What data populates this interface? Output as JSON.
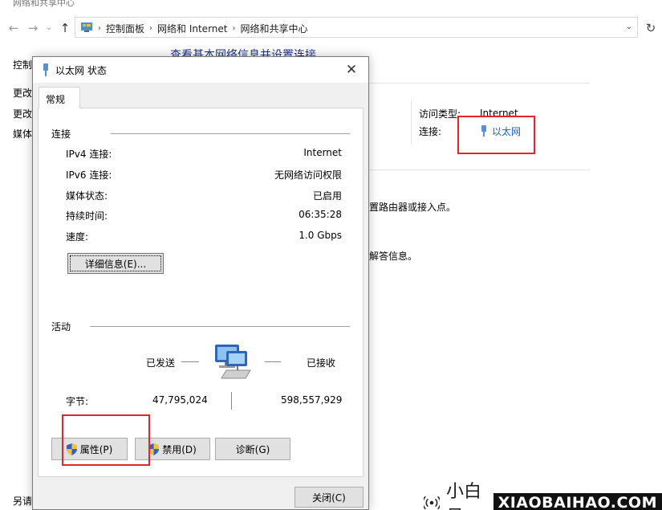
{
  "window": {
    "title": "网络和共享中心"
  },
  "address": {
    "crumbs": [
      "控制面板",
      "网络和 Internet",
      "网络和共享中心"
    ]
  },
  "page": {
    "heading": "查看基本网络信息并设置连接",
    "left_links": [
      "控制",
      "更改",
      "更改",
      "媒体",
      "另请"
    ],
    "access_type_label": "访问类型:",
    "access_type_value": "Internet",
    "connection_label": "连接:",
    "connection_value": "以太网",
    "partial_text_1": "置路由器或接入点。",
    "partial_text_2": "解答信息。"
  },
  "dialog": {
    "title": "以太网 状态",
    "tab": "常规",
    "connection_group": "连接",
    "rows": [
      {
        "label": "IPv4 连接:",
        "value": "Internet"
      },
      {
        "label": "IPv6 连接:",
        "value": "无网络访问权限"
      },
      {
        "label": "媒体状态:",
        "value": "已启用"
      },
      {
        "label": "持续时间:",
        "value": "06:35:28"
      },
      {
        "label": "速度:",
        "value": "1.0 Gbps"
      }
    ],
    "details_button": "详细信息(E)...",
    "activity_group": "活动",
    "sent_label": "已发送",
    "received_label": "已接收",
    "bytes_label": "字节:",
    "bytes_sent": "47,795,024",
    "bytes_received": "598,557,929",
    "properties_button": "属性(P)",
    "disable_button": "禁用(D)",
    "diagnose_button": "诊断(G)",
    "close_button": "关闭(C)"
  },
  "watermark": {
    "brand": "小白号",
    "url": "XIAOBAIHAO.COM"
  },
  "colors": {
    "highlight": "#e8242b",
    "link": "#1a5ec9"
  }
}
